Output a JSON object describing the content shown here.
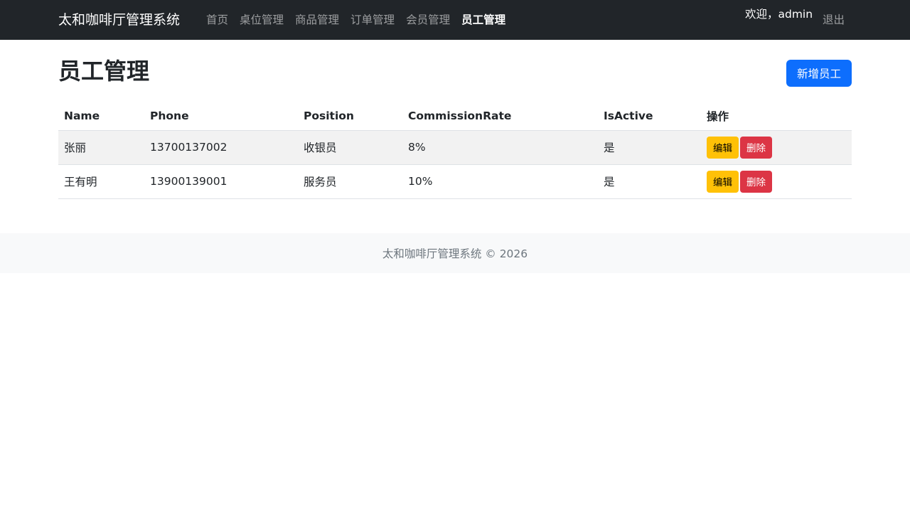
{
  "navbar": {
    "brand": "太和咖啡厅管理系统",
    "links": [
      {
        "label": "首页"
      },
      {
        "label": "桌位管理"
      },
      {
        "label": "商品管理"
      },
      {
        "label": "订单管理"
      },
      {
        "label": "会员管理"
      },
      {
        "label": "员工管理",
        "active": true
      }
    ],
    "welcome": "欢迎，admin",
    "logout": "退出"
  },
  "page": {
    "title": "员工管理",
    "add_button": "新增员工"
  },
  "table": {
    "columns": [
      "Name",
      "Phone",
      "Position",
      "CommissionRate",
      "IsActive",
      "操作"
    ],
    "rows": [
      {
        "name": "张丽",
        "phone": "13700137002",
        "position": "收银员",
        "commission": "8%",
        "active": "是",
        "edit": "编辑",
        "delete": "删除"
      },
      {
        "name": "王有明",
        "phone": "13900139001",
        "position": "服务员",
        "commission": "10%",
        "active": "是",
        "edit": "编辑",
        "delete": "删除"
      }
    ]
  },
  "footer": {
    "text": "太和咖啡厅管理系统 © 2026"
  },
  "colors": {
    "navbar_bg": "#212529",
    "primary": "#0d6efd",
    "warning": "#ffc107",
    "danger": "#dc3545",
    "footer_bg": "#f8f9fa"
  }
}
